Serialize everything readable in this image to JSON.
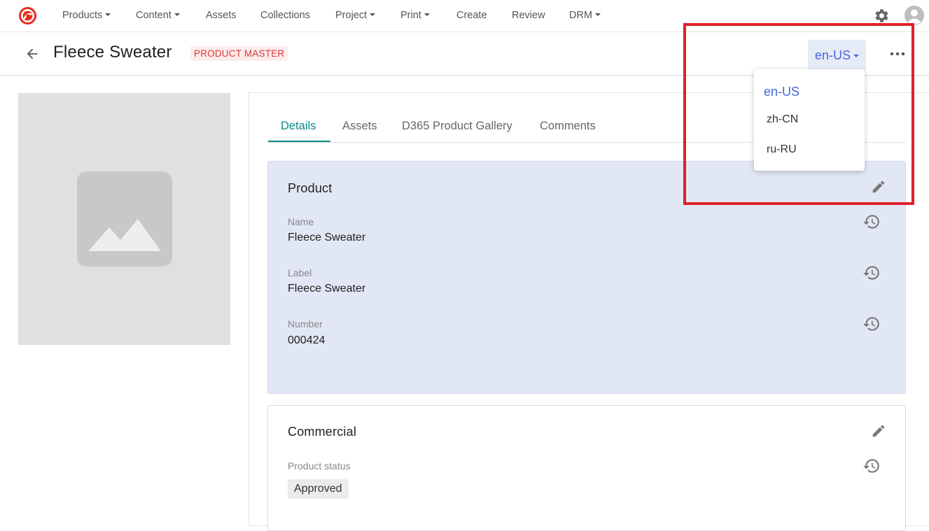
{
  "nav": {
    "items": [
      {
        "label": "Products",
        "has_caret": true
      },
      {
        "label": "Content",
        "has_caret": true
      },
      {
        "label": "Assets",
        "has_caret": false
      },
      {
        "label": "Collections",
        "has_caret": false
      },
      {
        "label": "Project",
        "has_caret": true
      },
      {
        "label": "Print",
        "has_caret": true
      },
      {
        "label": "Create",
        "has_caret": false
      },
      {
        "label": "Review",
        "has_caret": false
      },
      {
        "label": "DRM",
        "has_caret": true
      }
    ],
    "icons": {
      "logo": "sitecore-logo-icon",
      "settings": "gear-icon",
      "user": "user-avatar-icon"
    }
  },
  "header": {
    "title": "Fleece Sweater",
    "badge": "PRODUCT MASTER",
    "language": "en-US"
  },
  "language_menu": {
    "options": [
      "en-US",
      "zh-CN",
      "ru-RU"
    ],
    "selected": "en-US"
  },
  "tabs": [
    "Details",
    "Assets",
    "D365 Product Gallery",
    "Comments"
  ],
  "active_tab": "Details",
  "product": {
    "title": "Product",
    "fields": [
      {
        "label": "Name",
        "value": "Fleece Sweater"
      },
      {
        "label": "Label",
        "value": "Fleece Sweater"
      },
      {
        "label": "Number",
        "value": "000424"
      }
    ]
  },
  "commercial": {
    "title": "Commercial",
    "status_label": "Product status",
    "status_value": "Approved"
  },
  "colors": {
    "accent_teal": "#0a8a84",
    "language_blue": "#4a65d6",
    "badge_red": "#d93838",
    "highlight_red": "#e0202b",
    "card_blue": "#e2e7f5"
  }
}
